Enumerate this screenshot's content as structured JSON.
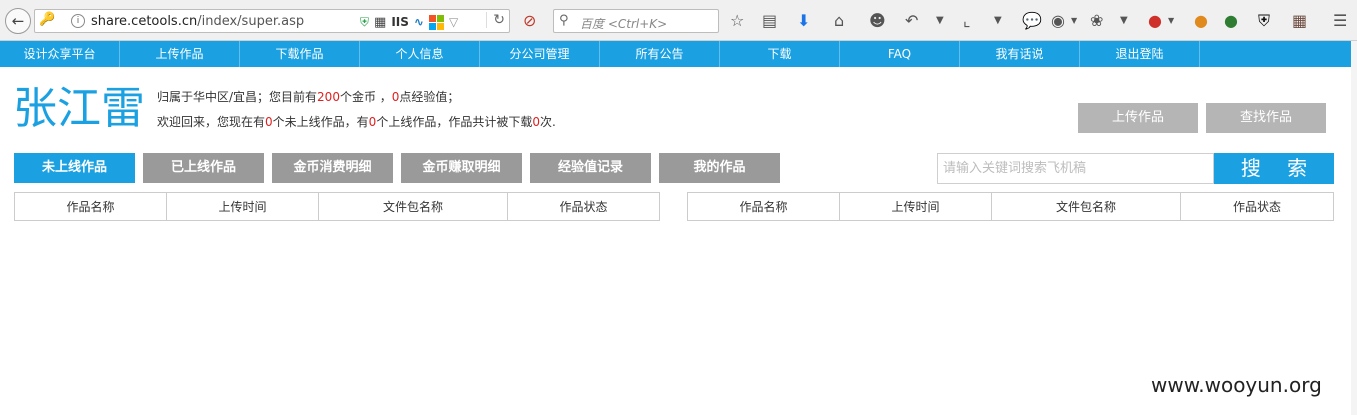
{
  "browser": {
    "url_host": "share.cetools.cn",
    "url_path": "/index/super.asp",
    "url_badge_iis": "IIS",
    "search_placeholder": "百度 <Ctrl+K>"
  },
  "nav": {
    "items": [
      "设计众享平台",
      "上传作品",
      "下载作品",
      "个人信息",
      "分公司管理",
      "所有公告",
      "下载",
      "FAQ",
      "我有话说",
      "退出登陆"
    ]
  },
  "user": {
    "name": "张江雷",
    "line1": {
      "prefix": "归属于华中区/宜昌；您目前有",
      "coins": "200",
      "mid": "个金币 ，",
      "exp": "0",
      "suffix": "点经验值；"
    },
    "line2": {
      "prefix": "欢迎回来，您现在有",
      "offline": "0",
      "mid1": "个未上线作品，有",
      "online": "0",
      "mid2": "个上线作品，作品共计被下载",
      "downloads": "0",
      "suffix": "次."
    }
  },
  "actions": {
    "upload": "上传作品",
    "find": "查找作品"
  },
  "tabs": [
    "未上线作品",
    "已上线作品",
    "金币消费明细",
    "金币赚取明细",
    "经验值记录",
    "我的作品"
  ],
  "search": {
    "placeholder": "请输入关键词搜索飞机稿",
    "button": "搜 索"
  },
  "table_left": {
    "columns": [
      "作品名称",
      "上传时间",
      "文件包名称",
      "作品状态"
    ]
  },
  "table_right": {
    "columns": [
      "作品名称",
      "上传时间",
      "文件包名称",
      "作品状态"
    ]
  },
  "watermark": "www.wooyun.org",
  "colors": {
    "accent": "#1ba1e2",
    "tab_inactive": "#9a9a9a",
    "button_gray": "#b5b5b5",
    "highlight_number": "#e02020"
  }
}
